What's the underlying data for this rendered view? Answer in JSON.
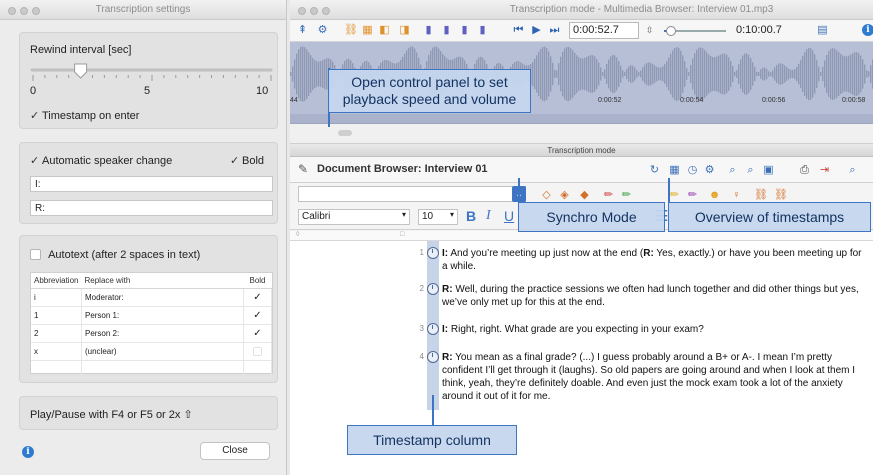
{
  "settings": {
    "title": "Transcription settings",
    "rewind_label": "Rewind interval [sec]",
    "slider_value_seconds": 2,
    "slider_min": "0",
    "slider_mid": "5",
    "slider_max": "10",
    "timestamp_on_enter": "Timestamp on enter",
    "auto_speaker_change": "Automatic speaker change",
    "bold_label": "Bold",
    "speaker1": "I:",
    "speaker2": "R:",
    "autotext_label": "Autotext (after 2 spaces in text)",
    "table_headers": [
      "Abbreviation",
      "Replace with",
      "Bold"
    ],
    "rows": [
      {
        "abbr": "i",
        "replace": "Moderator:",
        "bold": true
      },
      {
        "abbr": "1",
        "replace": "Person 1:",
        "bold": true
      },
      {
        "abbr": "2",
        "replace": "Person 2:",
        "bold": true
      },
      {
        "abbr": "x",
        "replace": "(unclear)",
        "bold": false
      }
    ],
    "play_pause": "Play/Pause with F4 or F5 or 2x ⇧",
    "close_label": "Close"
  },
  "main": {
    "title": "Transcription mode - Multimedia Browser: Interview 01.mp3",
    "position_time": "0:00:52.7",
    "duration_time": "0:10:00.7",
    "waveform_ticks": [
      "44",
      "0:00:52",
      "0:00:54",
      "0:00:56",
      "0:00:58"
    ],
    "transcription_mode_label": "Transcription mode",
    "document_browser": "Document Browser: Interview 01",
    "font_name": "Calibri",
    "font_size": "10",
    "bold_btn": "B",
    "italic_btn": "I",
    "underline_btn": "U",
    "paragraphs": [
      {
        "num": "1",
        "speaker": "I:",
        "text": " And you’re meeting up just now at the end (",
        "speaker_b": "R:",
        "text_b": " Yes, exactly.) or have you been meeting up for a while."
      },
      {
        "num": "2",
        "speaker": "R:",
        "text": " Well, during the practice sessions we often had lunch together and did other things but yes, we’ve only met up for this at the end.",
        "speaker_b": "",
        "text_b": ""
      },
      {
        "num": "3",
        "speaker": "I:",
        "text": " Right, right. What grade are you expecting in your exam?",
        "speaker_b": "",
        "text_b": ""
      },
      {
        "num": "4",
        "speaker": "R:",
        "text": "  You mean as a final grade? (...) I guess probably around a B+ or A-. I mean I’m pretty confident I’ll get through it (laughs). So old papers are going around and when I look at them I think, yeah, they’re definitely doable. And even just the mock exam took a lot of the anxiety around it out of it for me.",
        "speaker_b": "",
        "text_b": ""
      }
    ]
  },
  "callouts": {
    "control_panel": "Open control panel to set playback speed and volume",
    "synchro_mode": "Synchro Mode",
    "overview_timestamps": "Overview of timestamps",
    "timestamp_column": "Timestamp column"
  },
  "colors": {
    "accent": "#3d74c4",
    "waveform_bg": "#b6bfd6",
    "timestamp_column": "#c7d3e6"
  }
}
